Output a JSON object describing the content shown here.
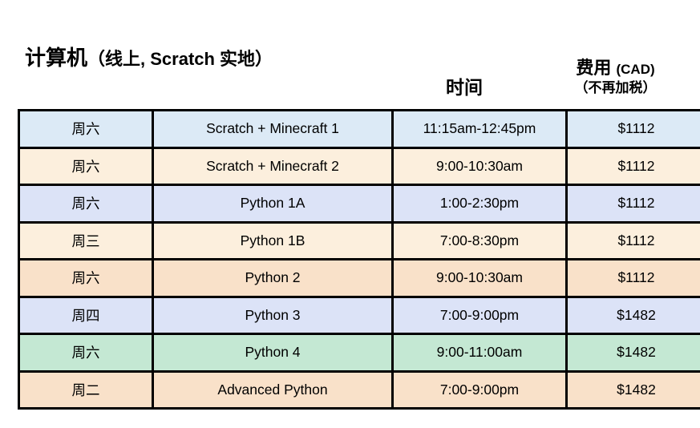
{
  "title": {
    "main": "计算机",
    "paren": "（线上, Scratch 实地）"
  },
  "headers": {
    "time": "时间",
    "fee_main": "费用",
    "fee_currency": "(CAD)",
    "fee_sub": "（不再加税）"
  },
  "colors": {
    "row_light_blue": "#dceaf6",
    "row_cream": "#fcefdd",
    "row_lavender": "#dce3f7",
    "row_peach": "#f9e1c9",
    "row_mint": "#c4e8d3",
    "border": "#000000",
    "text": "#000000",
    "background": "#ffffff"
  },
  "table": {
    "columns": [
      "day",
      "course",
      "time",
      "price"
    ],
    "rows": [
      {
        "day": "周六",
        "course": "Scratch + Minecraft 1",
        "time": "11:15am-12:45pm",
        "price": "$1112",
        "color": "#dceaf6"
      },
      {
        "day": "周六",
        "course": "Scratch + Minecraft 2",
        "time": "9:00-10:30am",
        "price": "$1112",
        "color": "#fcefdd"
      },
      {
        "day": "周六",
        "course": "Python 1A",
        "time": "1:00-2:30pm",
        "price": "$1112",
        "color": "#dce3f7"
      },
      {
        "day": "周三",
        "course": "Python 1B",
        "time": "7:00-8:30pm",
        "price": "$1112",
        "color": "#fcefdd"
      },
      {
        "day": "周六",
        "course": "Python 2",
        "time": "9:00-10:30am",
        "price": "$1112",
        "color": "#f9e1c9"
      },
      {
        "day": "周四",
        "course": "Python 3",
        "time": "7:00-9:00pm",
        "price": "$1482",
        "color": "#dce3f7"
      },
      {
        "day": "周六",
        "course": "Python 4",
        "time": "9:00-11:00am",
        "price": "$1482",
        "color": "#c4e8d3"
      },
      {
        "day": "周二",
        "course": "Advanced Python",
        "time": "7:00-9:00pm",
        "price": "$1482",
        "color": "#f9e1c9"
      }
    ]
  }
}
